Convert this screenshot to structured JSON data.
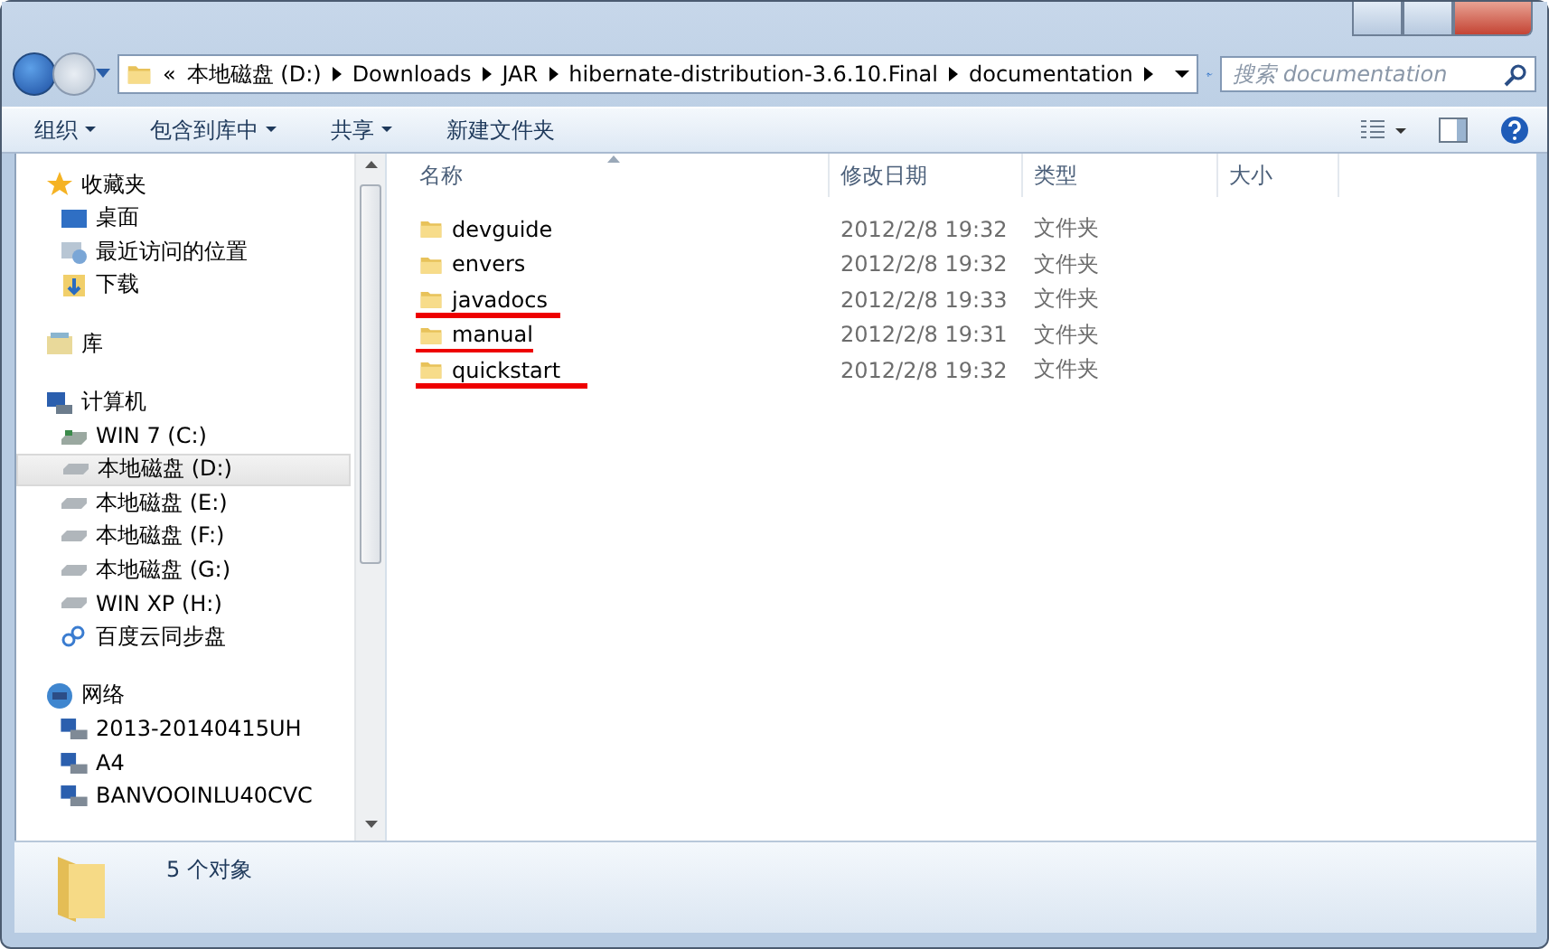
{
  "address": {
    "overflow": "«",
    "crumbs": [
      "本地磁盘 (D:)",
      "Downloads",
      "JAR",
      "hibernate-distribution-3.6.10.Final",
      "documentation"
    ]
  },
  "search": {
    "placeholder": "搜索 documentation"
  },
  "toolbar": [
    {
      "label": "组织",
      "menu": true
    },
    {
      "label": "包含到库中",
      "menu": true
    },
    {
      "label": "共享",
      "menu": true
    },
    {
      "label": "新建文件夹",
      "menu": false
    }
  ],
  "nav": [
    {
      "label": "收藏夹",
      "kind": "star",
      "selected": false,
      "children": [
        {
          "label": "桌面",
          "kind": "desktop",
          "selected": false
        },
        {
          "label": "最近访问的位置",
          "kind": "recent",
          "selected": false
        },
        {
          "label": "下载",
          "kind": "download",
          "selected": false
        }
      ]
    },
    {
      "label": "库",
      "kind": "library",
      "selected": false
    },
    {
      "label": "计算机",
      "kind": "computer",
      "selected": false,
      "children": [
        {
          "label": "WIN 7 (C:)",
          "kind": "sysdrive",
          "selected": false
        },
        {
          "label": "本地磁盘 (D:)",
          "kind": "drive",
          "selected": true
        },
        {
          "label": "本地磁盘 (E:)",
          "kind": "drive",
          "selected": false
        },
        {
          "label": "本地磁盘 (F:)",
          "kind": "drive",
          "selected": false
        },
        {
          "label": "本地磁盘 (G:)",
          "kind": "drive",
          "selected": false
        },
        {
          "label": "WIN XP (H:)",
          "kind": "drive",
          "selected": false
        },
        {
          "label": "百度云同步盘",
          "kind": "cloud",
          "selected": false
        }
      ]
    },
    {
      "label": "网络",
      "kind": "network",
      "selected": false,
      "children": [
        {
          "label": "2013-20140415UH",
          "kind": "pc",
          "selected": false
        },
        {
          "label": "A4",
          "kind": "pc",
          "selected": false
        },
        {
          "label": "BANVOOINLU40CVC",
          "kind": "pc",
          "selected": false
        }
      ]
    }
  ],
  "columns": [
    "名称",
    "修改日期",
    "类型",
    "大小"
  ],
  "rows": [
    {
      "name": "devguide",
      "modified": "2012/2/8 19:32",
      "type": "文件夹",
      "underlined": false
    },
    {
      "name": "envers",
      "modified": "2012/2/8 19:32",
      "type": "文件夹",
      "underlined": false
    },
    {
      "name": "javadocs",
      "modified": "2012/2/8 19:33",
      "type": "文件夹",
      "underlined": true
    },
    {
      "name": "manual",
      "modified": "2012/2/8 19:31",
      "type": "文件夹",
      "underlined": true
    },
    {
      "name": "quickstart",
      "modified": "2012/2/8 19:32",
      "type": "文件夹",
      "underlined": true
    }
  ],
  "status": "5 个对象"
}
